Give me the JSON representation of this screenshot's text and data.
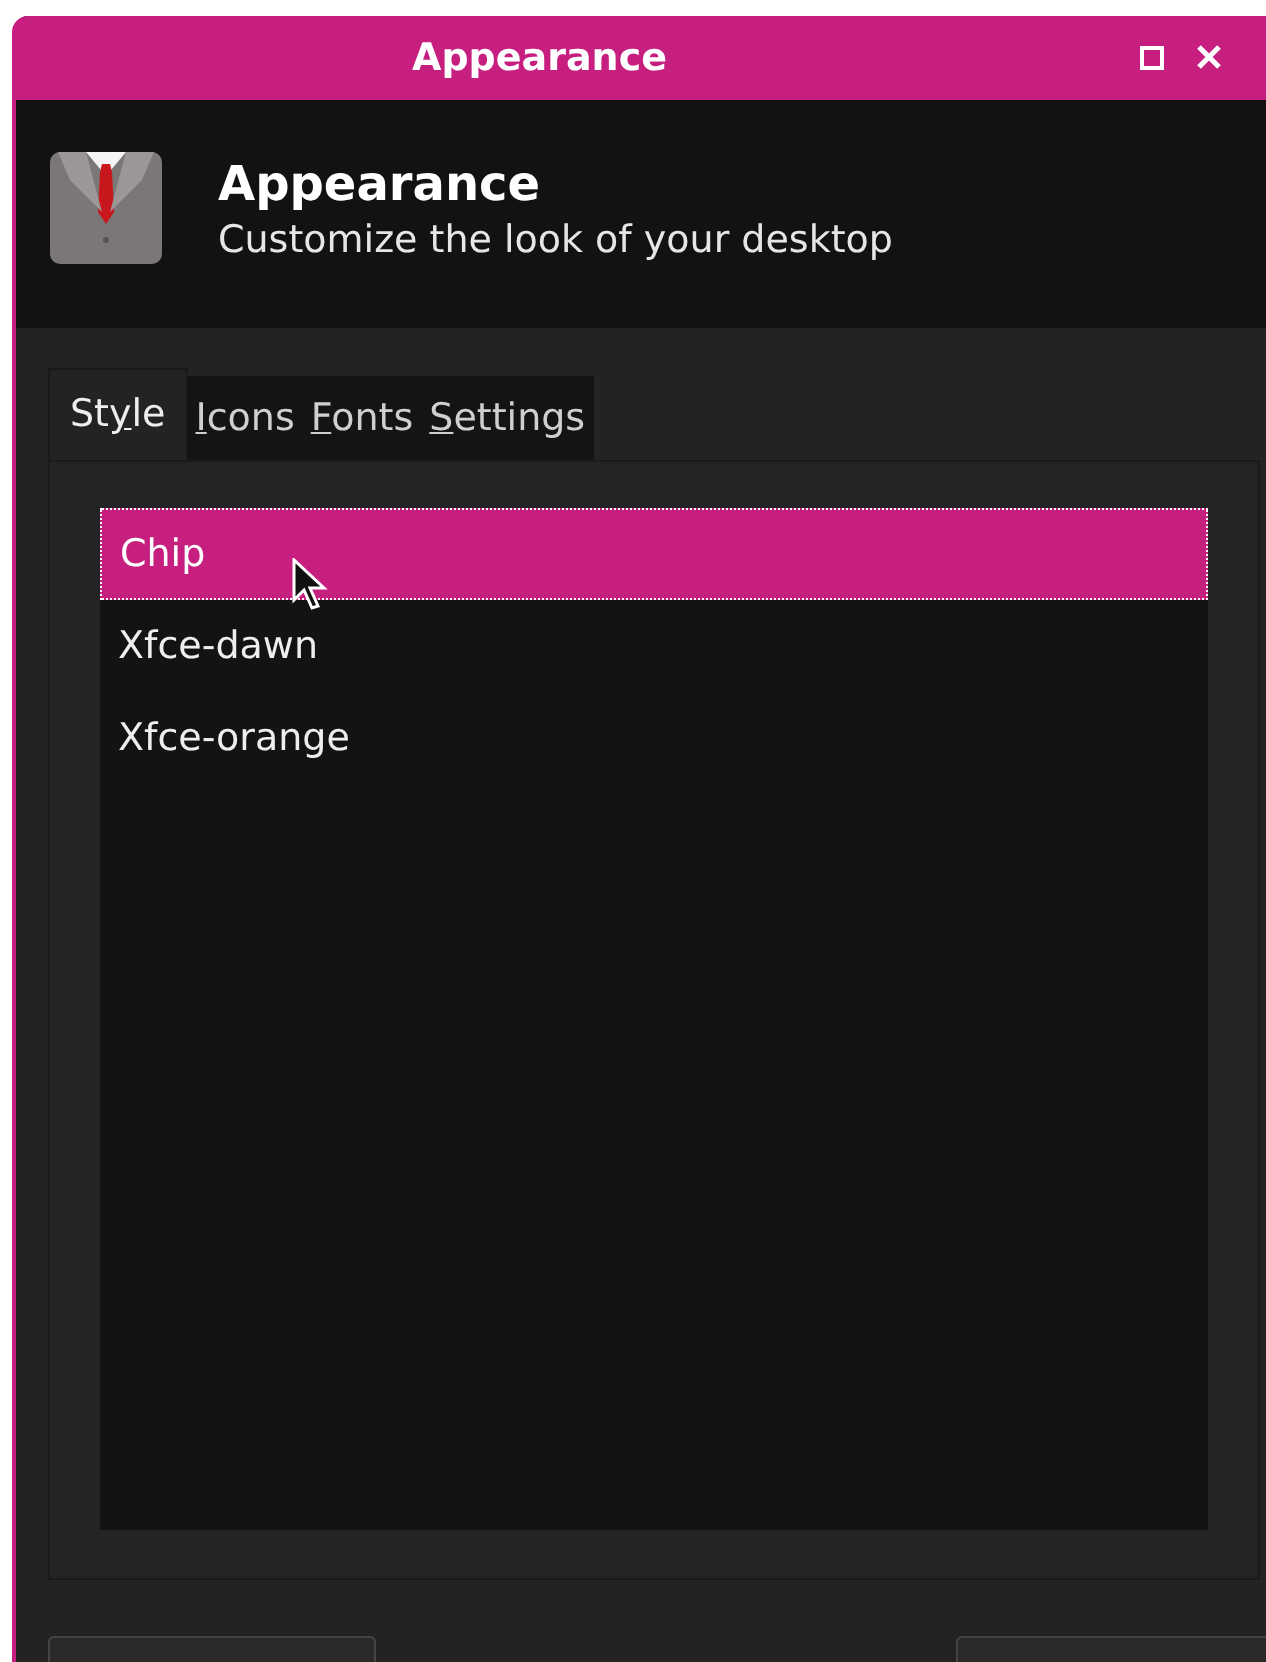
{
  "window": {
    "title": "Appearance",
    "controls": [
      {
        "kind": "maximize"
      },
      {
        "kind": "close"
      }
    ]
  },
  "header": {
    "title": "Appearance",
    "subtitle": "Customize the look of your desktop"
  },
  "tabs": [
    {
      "before": "St",
      "key": "y",
      "after": "le",
      "selected": true
    },
    {
      "key": "I",
      "after": "cons",
      "selected": false
    },
    {
      "key": "F",
      "after": "onts",
      "selected": false
    },
    {
      "key": "S",
      "after": "ettings",
      "selected": false
    }
  ],
  "styles": [
    {
      "name": "Chip",
      "selected": true
    },
    {
      "name": "Xfce-dawn",
      "selected": false
    },
    {
      "name": "Xfce-orange",
      "selected": false
    }
  ],
  "bottom_buttons": [
    {
      "kind": "left"
    },
    {
      "kind": "right"
    }
  ]
}
